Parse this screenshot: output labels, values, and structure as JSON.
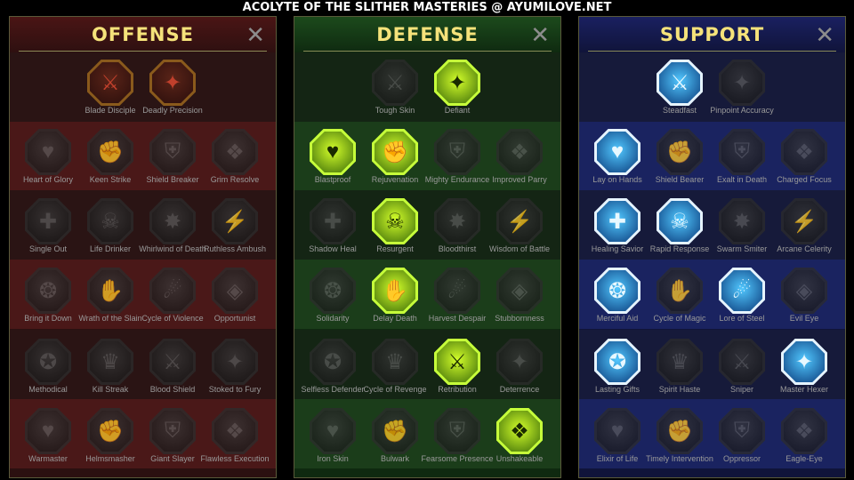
{
  "title": "ACOLYTE OF THE SLITHER MASTERIES @ AYUMILOVE.NET",
  "panels": [
    {
      "id": "offense",
      "header": "OFFENSE",
      "close_icon": "close-icon",
      "rows": [
        [
          "Blade Disciple",
          "Deadly Precision"
        ],
        [
          "Heart of Glory",
          "Keen Strike",
          "Shield Breaker",
          "Grim Resolve"
        ],
        [
          "Single Out",
          "Life Drinker",
          "Whirlwind of Death",
          "Ruthless Ambush"
        ],
        [
          "Bring it Down",
          "Wrath of the Slain",
          "Cycle of Violence",
          "Opportunist"
        ],
        [
          "Methodical",
          "Kill Streak",
          "Blood Shield",
          "Stoked to Fury"
        ],
        [
          "Warmaster",
          "Helmsmasher",
          "Giant Slayer",
          "Flawless Execution"
        ]
      ],
      "active": [
        "Blade Disciple",
        "Deadly Precision"
      ],
      "icons": [
        "crossed-swords-icon",
        "dagger-icon",
        "helmet-icon",
        "slash-icon",
        "shield-icon",
        "heart-icon",
        "fist-icon",
        "fangs-icon",
        "whirlwind-icon",
        "ambush-icon",
        "target-icon",
        "hammer-icon",
        "axe-icon",
        "chains-icon",
        "spider-icon",
        "skull-icon",
        "blade-shield-icon",
        "fury-icon",
        "warmaster-icon",
        "helm-icon",
        "giant-icon",
        "execution-icon"
      ]
    },
    {
      "id": "defense",
      "header": "DEFENSE",
      "close_icon": "close-icon",
      "rows": [
        [
          "Tough Skin",
          "Defiant"
        ],
        [
          "Blastproof",
          "Rejuvenation",
          "Mighty Endurance",
          "Improved Parry"
        ],
        [
          "Shadow Heal",
          "Resurgent",
          "Bloodthirst",
          "Wisdom of Battle"
        ],
        [
          "Solidarity",
          "Delay Death",
          "Harvest Despair",
          "Stubbornness"
        ],
        [
          "Selfless Defender",
          "Cycle of Revenge",
          "Retribution",
          "Deterrence"
        ],
        [
          "Iron Skin",
          "Bulwark",
          "Fearsome Presence",
          "Unshakeable"
        ]
      ],
      "active": [
        "Defiant",
        "Blastproof",
        "Rejuvenation",
        "Resurgent",
        "Delay Death",
        "Retribution",
        "Unshakeable"
      ]
    },
    {
      "id": "support",
      "header": "SUPPORT",
      "close_icon": "close-icon",
      "rows": [
        [
          "Steadfast",
          "Pinpoint Accuracy"
        ],
        [
          "Lay on Hands",
          "Shield Bearer",
          "Exalt in Death",
          "Charged Focus"
        ],
        [
          "Healing Savior",
          "Rapid Response",
          "Swarm Smiter",
          "Arcane Celerity"
        ],
        [
          "Merciful Aid",
          "Cycle of Magic",
          "Lore of Steel",
          "Evil Eye"
        ],
        [
          "Lasting Gifts",
          "Spirit Haste",
          "Sniper",
          "Master Hexer"
        ],
        [
          "Elixir of Life",
          "Timely Intervention",
          "Oppressor",
          "Eagle-Eye"
        ]
      ],
      "active": [
        "Steadfast",
        "Lay on Hands",
        "Healing Savior",
        "Rapid Response",
        "Merciful Aid",
        "Lore of Steel",
        "Lasting Gifts",
        "Master Hexer"
      ]
    }
  ]
}
